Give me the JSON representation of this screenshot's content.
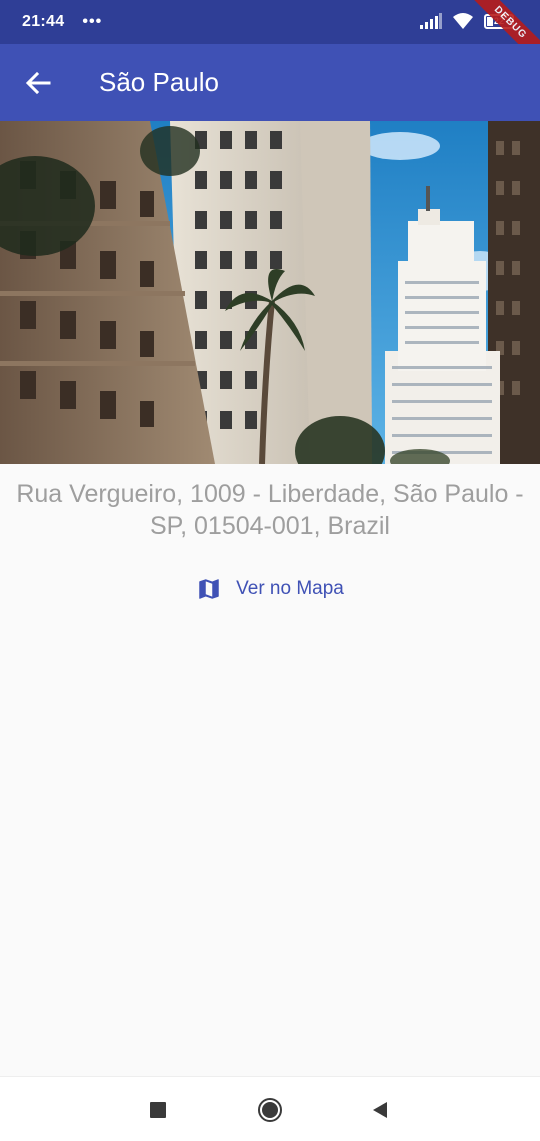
{
  "status_bar": {
    "time": "21:44",
    "dots": "•••",
    "battery_label": "22",
    "debug_label": "DEBUG"
  },
  "app_bar": {
    "title": "São Paulo",
    "back_icon": "arrow-back-icon",
    "background": "#3f51b5"
  },
  "hero": {
    "subject": "sao-paulo-buildings-photo"
  },
  "address": {
    "line1": "Rua Vergueiro, 1009 - Liberdade, São Paulo -",
    "line2": "SP, 01504-001, Brazil"
  },
  "map_link": {
    "label": "Ver no Mapa",
    "icon": "map-icon",
    "color": "#3f51b5"
  },
  "nav_bar": {
    "recents_icon": "square-icon",
    "home_icon": "circle-icon",
    "back_icon": "triangle-back-icon"
  }
}
